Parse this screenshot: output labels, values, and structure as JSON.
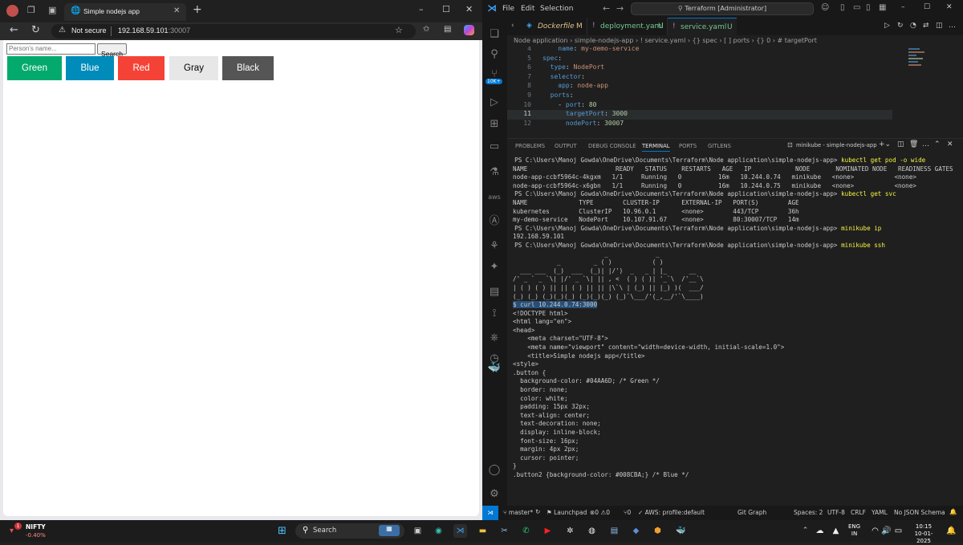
{
  "browser": {
    "tab_title": "Simple nodejs app",
    "security_label": "Not secure",
    "url_host": "192.168.59.101",
    "url_port": ":30007",
    "page": {
      "name_placeholder": "Person's name...",
      "search_label": "Search",
      "buttons": [
        {
          "label": "Green",
          "color": "#04AA6D",
          "text": "#ffffff"
        },
        {
          "label": "Blue",
          "color": "#008CBA",
          "text": "#ffffff"
        },
        {
          "label": "Red",
          "color": "#f44336",
          "text": "#ffffff"
        },
        {
          "label": "Gray",
          "color": "#e7e7e7",
          "text": "#000000"
        },
        {
          "label": "Black",
          "color": "#555555",
          "text": "#ffffff"
        }
      ]
    }
  },
  "vscode": {
    "menu": [
      "File",
      "Edit",
      "Selection"
    ],
    "command_center": "Terraform [Administrator]",
    "tabs": [
      {
        "name": "Dockerfile",
        "badge": "M",
        "color": "#e2c08d"
      },
      {
        "name": "deployment.yaml",
        "badge": "U",
        "color": "#73c991"
      },
      {
        "name": "service.yaml",
        "badge": "U",
        "color": "#73c991"
      }
    ],
    "breadcrumb": "Node application › simple-nodejs-app › ! service.yaml › {} spec › [ ] ports › {} 0 › # targetPort",
    "code": [
      {
        "n": "4",
        "t": "    name: my-demo-service"
      },
      {
        "n": "5",
        "t": "spec:"
      },
      {
        "n": "6",
        "t": "  type: NodePort"
      },
      {
        "n": "7",
        "t": "  selector:"
      },
      {
        "n": "8",
        "t": "    app: node-app"
      },
      {
        "n": "9",
        "t": "  ports:"
      },
      {
        "n": "10",
        "t": "    - port: 80"
      },
      {
        "n": "11",
        "t": "      targetPort: 3000"
      },
      {
        "n": "12",
        "t": "      nodePort: 30007"
      }
    ],
    "panel_tabs": [
      "PROBLEMS",
      "OUTPUT",
      "DEBUG CONSOLE",
      "TERMINAL",
      "PORTS",
      "GITLENS"
    ],
    "terminal_name": "minikube - simple-nodejs-app",
    "terminal_lines": [
      "PS C:\\Users\\Manoj Gowda\\OneDrive\\Documents\\Terraform\\Node application\\simple-nodejs-app> kubectl get pod -o wide",
      "NAME                        READY   STATUS    RESTARTS   AGE   IP            NODE       NOMINATED NODE   READINESS GATES",
      "node-app-ccbf5964c-4kgxm   1/1     Running   0          16m   10.244.0.74   minikube   <none>           <none>",
      "node-app-ccbf5964c-x6gbn   1/1     Running   0          16m   10.244.0.75   minikube   <none>           <none>",
      "PS C:\\Users\\Manoj Gowda\\OneDrive\\Documents\\Terraform\\Node application\\simple-nodejs-app> kubectl get svc",
      "NAME              TYPE        CLUSTER-IP      EXTERNAL-IP   PORT(S)        AGE",
      "kubernetes        ClusterIP   10.96.0.1       <none>        443/TCP        36h",
      "my-demo-service   NodePort    10.107.91.67    <none>        80:30007/TCP   14m",
      "PS C:\\Users\\Manoj Gowda\\OneDrive\\Documents\\Terraform\\Node application\\simple-nodejs-app> minikube ip",
      "192.168.59.101",
      "PS C:\\Users\\Manoj Gowda\\OneDrive\\Documents\\Terraform\\Node application\\simple-nodejs-app> minikube ssh",
      "",
      "                         _             _",
      "            _         _ ( )           ( )",
      "  ___ ___  (_)  ___  (_)| |/')  _   _ | |_      __",
      "/' _ ` _ `\\| |/' _ `\\| || , <  ( ) ( )| '_`\\  /'__`\\",
      "| ( ) ( ) || || ( ) || || |\\`\\ | (_) || |_) )(  ___/",
      "(_) (_) (_)(_)(_) (_)(_)(_) (_)`\\___/'(_,__/'`\\____)",
      "",
      "$ curl 10.244.0.74:3000",
      "<!DOCTYPE html>",
      "<html lang=\"en\">",
      "<head>",
      "    <meta charset=\"UTF-8\">",
      "    <meta name=\"viewport\" content=\"width=device-width, initial-scale=1.0\">",
      "    <title>Simple nodejs app</title>",
      "",
      "<style>",
      ".button {",
      "  background-color: #04AA6D; /* Green */",
      "  border: none;",
      "  color: white;",
      "  padding: 15px 32px;",
      "  text-align: center;",
      "  text-decoration: none;",
      "  display: inline-block;",
      "  font-size: 16px;",
      "  margin: 4px 2px;",
      "  cursor: pointer;",
      "}",
      "",
      ".button2 {background-color: #008CBA;} /* Blue */"
    ],
    "status": {
      "branch": "master*",
      "launchpad": "Launchpad",
      "errors": "0",
      "warnings": "0",
      "info": "0",
      "aws": "AWS: profile:default",
      "git_graph": "Git Graph",
      "spaces": "Spaces: 2",
      "encoding": "UTF-8",
      "eol": "CRLF",
      "lang": "YAML",
      "schema": "No JSON Schema"
    }
  },
  "taskbar": {
    "widget_name": "NIFTY",
    "widget_value": "-0.40%",
    "search": "Search",
    "lang": "ENG",
    "region": "IN",
    "time": "10:15",
    "date": "10-01-2025",
    "notif": "1"
  }
}
